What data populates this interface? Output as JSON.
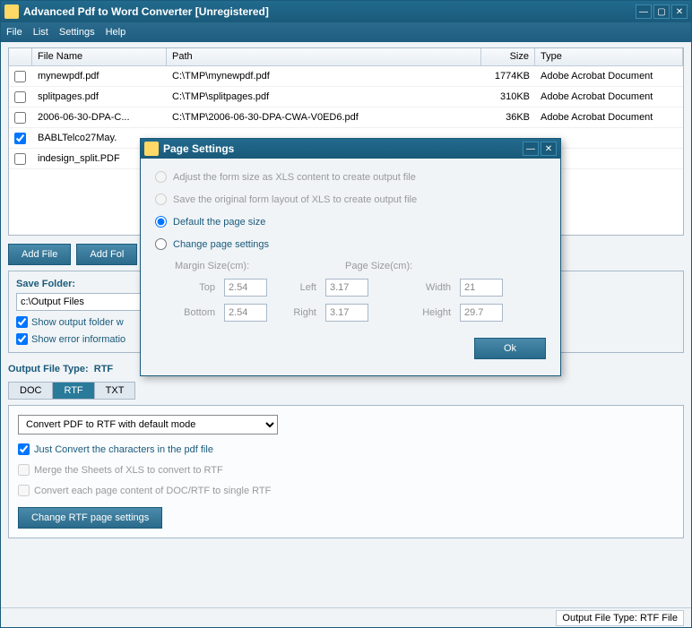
{
  "window": {
    "title": "Advanced Pdf to Word Converter [Unregistered]"
  },
  "menu": [
    "File",
    "List",
    "Settings",
    "Help"
  ],
  "grid": {
    "headers": {
      "name": "File Name",
      "path": "Path",
      "size": "Size",
      "type": "Type"
    },
    "rows": [
      {
        "checked": false,
        "name": "mynewpdf.pdf",
        "path": "C:\\TMP\\mynewpdf.pdf",
        "size": "1774KB",
        "type": "Adobe Acrobat Document"
      },
      {
        "checked": false,
        "name": "splitpages.pdf",
        "path": "C:\\TMP\\splitpages.pdf",
        "size": "310KB",
        "type": "Adobe Acrobat Document"
      },
      {
        "checked": false,
        "name": "2006-06-30-DPA-C...",
        "path": "C:\\TMP\\2006-06-30-DPA-CWA-V0ED6.pdf",
        "size": "36KB",
        "type": "Adobe Acrobat Document"
      },
      {
        "checked": true,
        "name": "BABLTelco27May.",
        "path": "",
        "size": "",
        "type": ""
      },
      {
        "checked": false,
        "name": "indesign_split.PDF",
        "path": "",
        "size": "",
        "type": ""
      }
    ]
  },
  "buttons": {
    "addFile": "Add File",
    "addFolder": "Add Fol"
  },
  "saveFolder": {
    "label": "Save Folder:",
    "path": "c:\\Output Files",
    "showOutput": "Show output folder w",
    "showError": "Show error informatio"
  },
  "outputType": {
    "label": "Output File Type:",
    "value": "RTF"
  },
  "tabs": [
    "DOC",
    "RTF",
    "TXT"
  ],
  "rtfPanel": {
    "mode": "Convert PDF to RTF with default mode",
    "justChars": "Just Convert the characters in the pdf file",
    "merge": "Merge the Sheets of XLS to convert to RTF",
    "each": "Convert each page content of DOC/RTF to single RTF",
    "changeBtn": "Change RTF page settings"
  },
  "status": "Output File Type:   RTF File",
  "dialog": {
    "title": "Page Settings",
    "opt1": "Adjust the form size as XLS content to create output file",
    "opt2": "Save the original form layout of XLS to create output file",
    "opt3": "Default the page size",
    "opt4": "Change page settings",
    "marginLabel": "Margin Size(cm):",
    "pageLabel": "Page Size(cm):",
    "top": "Top",
    "topVal": "2.54",
    "left": "Left",
    "leftVal": "3.17",
    "bottom": "Bottom",
    "bottomVal": "2.54",
    "right": "Right",
    "rightVal": "3.17",
    "width": "Width",
    "widthVal": "21",
    "height": "Height",
    "heightVal": "29.7",
    "ok": "Ok"
  }
}
